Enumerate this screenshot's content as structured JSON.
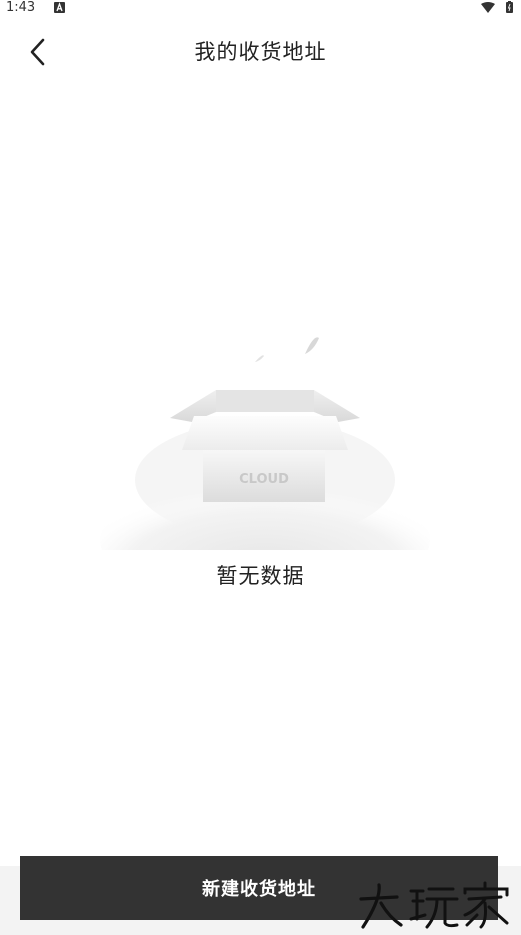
{
  "status_bar": {
    "time": "1:43",
    "app_icon": "a-letter-icon",
    "wifi_icon": "wifi-icon",
    "battery_icon": "battery-icon"
  },
  "header": {
    "title": "我的收货地址",
    "back_icon": "chevron-left-icon"
  },
  "empty_state": {
    "illustration": "empty-box-icon",
    "box_label": "CLOUD",
    "message": "暂无数据"
  },
  "footer": {
    "new_address_label": "新建收货地址"
  },
  "watermark": {
    "text": "大玩家"
  },
  "colors": {
    "button_bg": "#333333",
    "button_text": "#ffffff",
    "text_primary": "#222222",
    "footer_bg": "#f3f3f3"
  }
}
